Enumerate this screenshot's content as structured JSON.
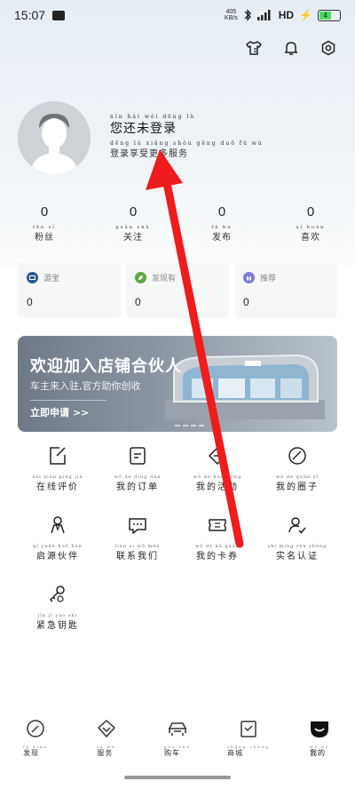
{
  "status_bar": {
    "time": "15:07",
    "net_speed_top": "405",
    "net_speed_bottom": "KB/s",
    "network": "HD",
    "battery": "4"
  },
  "profile": {
    "title_pinyin": "nín hái wèi dēng lù",
    "title": "您还未登录",
    "sub_pinyin": "dēng lù xiǎng shòu gēng duō fú wù",
    "subtitle": "登录享受更多服务"
  },
  "stats": [
    {
      "value": "0",
      "pinyin": "fěn sī",
      "label": "粉丝"
    },
    {
      "value": "0",
      "pinyin": "guān zhù",
      "label": "关注"
    },
    {
      "value": "0",
      "pinyin": "fā bù",
      "label": "发布"
    },
    {
      "value": "0",
      "pinyin": "xǐ huān",
      "label": "喜欢"
    }
  ],
  "cards": [
    {
      "label": "源宝",
      "value": "0",
      "color": "#2a5b8c"
    },
    {
      "label": "发现有",
      "value": "0",
      "color": "#5aa83f"
    },
    {
      "label": "推荐",
      "value": "0",
      "color": "#7b7fd6"
    }
  ],
  "banner": {
    "title": "欢迎加入店铺合伙人",
    "subtitle": "车主来入驻,官方助你创收",
    "cta": "立即申请 >>"
  },
  "grid": [
    {
      "pinyin": "zài xiàn píng jià",
      "label": "在线评价",
      "icon": "edit-icon"
    },
    {
      "pinyin": "wǒ de dìng dān",
      "label": "我的订单",
      "icon": "order-icon"
    },
    {
      "pinyin": "wǒ de huó dòng",
      "label": "我的活动",
      "icon": "ticket-icon"
    },
    {
      "pinyin": "wǒ de quān zǐ",
      "label": "我的圈子",
      "icon": "circle-icon"
    },
    {
      "pinyin": "qǐ yuán huǒ bàn",
      "label": "启源伙伴",
      "icon": "partner-icon"
    },
    {
      "pinyin": "lián xì wǒ men",
      "label": "联系我们",
      "icon": "chat-icon"
    },
    {
      "pinyin": "wǒ de kǎ quàn",
      "label": "我的卡券",
      "icon": "coupon-icon"
    },
    {
      "pinyin": "shí míng rèn zhèng",
      "label": "实名认证",
      "icon": "user-verify-icon"
    },
    {
      "pinyin": "jǐn jí yào shi",
      "label": "紧急钥匙",
      "icon": "key-icon"
    }
  ],
  "bottom_nav": [
    {
      "pinyin": "fā xiàn",
      "label": "发现",
      "icon": "discover-icon"
    },
    {
      "pinyin": "fú wù",
      "label": "服务",
      "icon": "service-icon"
    },
    {
      "pinyin": "gòu chē",
      "label": "购车",
      "icon": "car-icon"
    },
    {
      "pinyin": "shāng chéng",
      "label": "商城",
      "icon": "mall-icon"
    },
    {
      "pinyin": "wǒ de",
      "label": "我的",
      "icon": "me-icon"
    }
  ],
  "colors": {
    "annotation_arrow": "#ee1c1c",
    "active_nav": "#111111"
  }
}
